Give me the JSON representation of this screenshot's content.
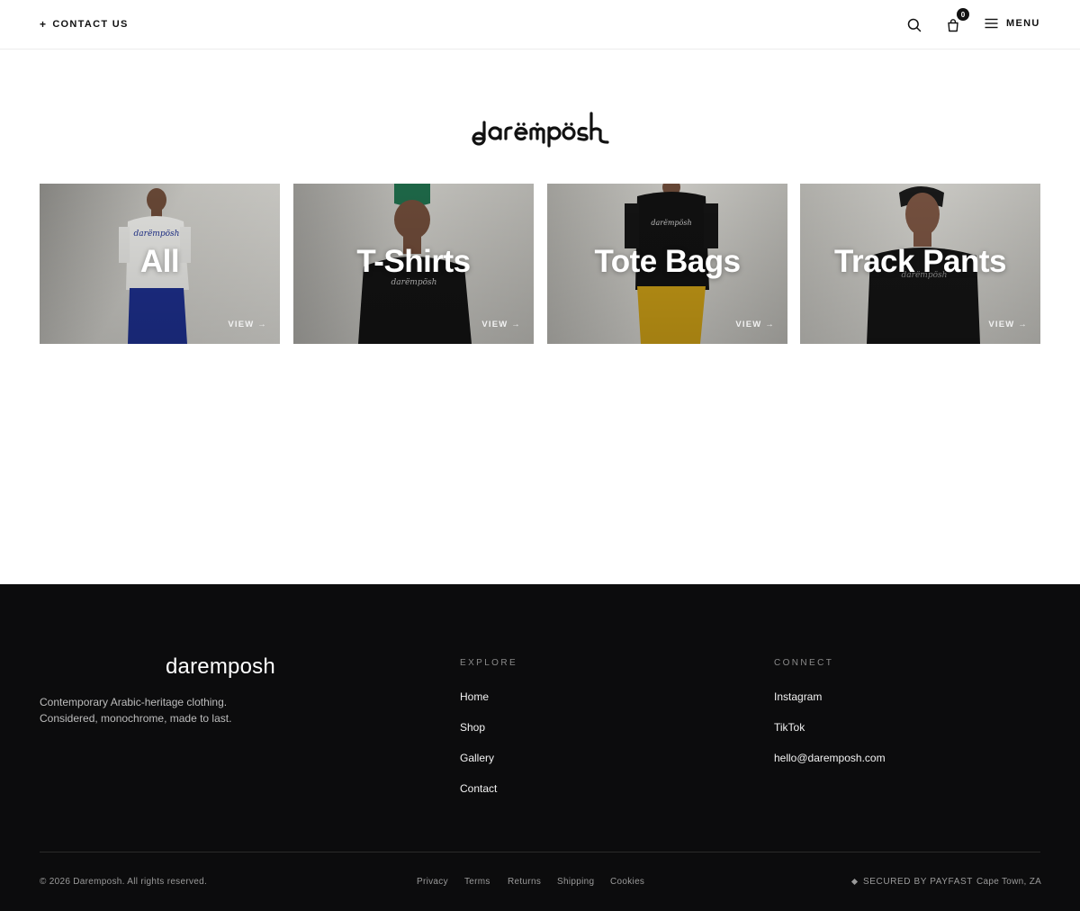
{
  "header": {
    "contact_label": "CONTACT US",
    "contact_icon": "plus-icon",
    "cart_count": "0",
    "menu_label": "MENU"
  },
  "logo": {
    "text": "darëmpösh"
  },
  "categories": [
    {
      "title": "All",
      "cta": "VIEW →",
      "shirt": "#e9e9e6",
      "pants": "#1d2f8c"
    },
    {
      "title": "T-Shirts",
      "cta": "VIEW →",
      "shirt": "#121212",
      "hat": "#1f6b4a"
    },
    {
      "title": "Tote Bags",
      "cta": "VIEW →",
      "shirt": "#111111",
      "pants": "#c79b16"
    },
    {
      "title": "Track Pants",
      "cta": "VIEW →",
      "shirt": "#141414"
    }
  ],
  "footer": {
    "brand": "daremposh",
    "tagline_line1": "Contemporary Arabic-heritage clothing.",
    "tagline_line2": "Considered, monochrome, made to last.",
    "explore_heading": "EXPLORE",
    "explore_links": [
      "Home",
      "Shop",
      "Gallery",
      "Contact"
    ],
    "connect_heading": "CONNECT",
    "connect_links": [
      "Instagram",
      "TikTok",
      "hello@daremposh.com"
    ],
    "copyright": "© 2026 Daremposh. All rights reserved.",
    "legal_links": [
      "Privacy",
      "Terms",
      "Returns",
      "Shipping",
      "Cookies"
    ],
    "secured": "SECURED BY PAYFAST",
    "location": "Cape Town, ZA"
  },
  "colors": {
    "footer_bg": "#0c0c0d",
    "text": "#111111"
  }
}
